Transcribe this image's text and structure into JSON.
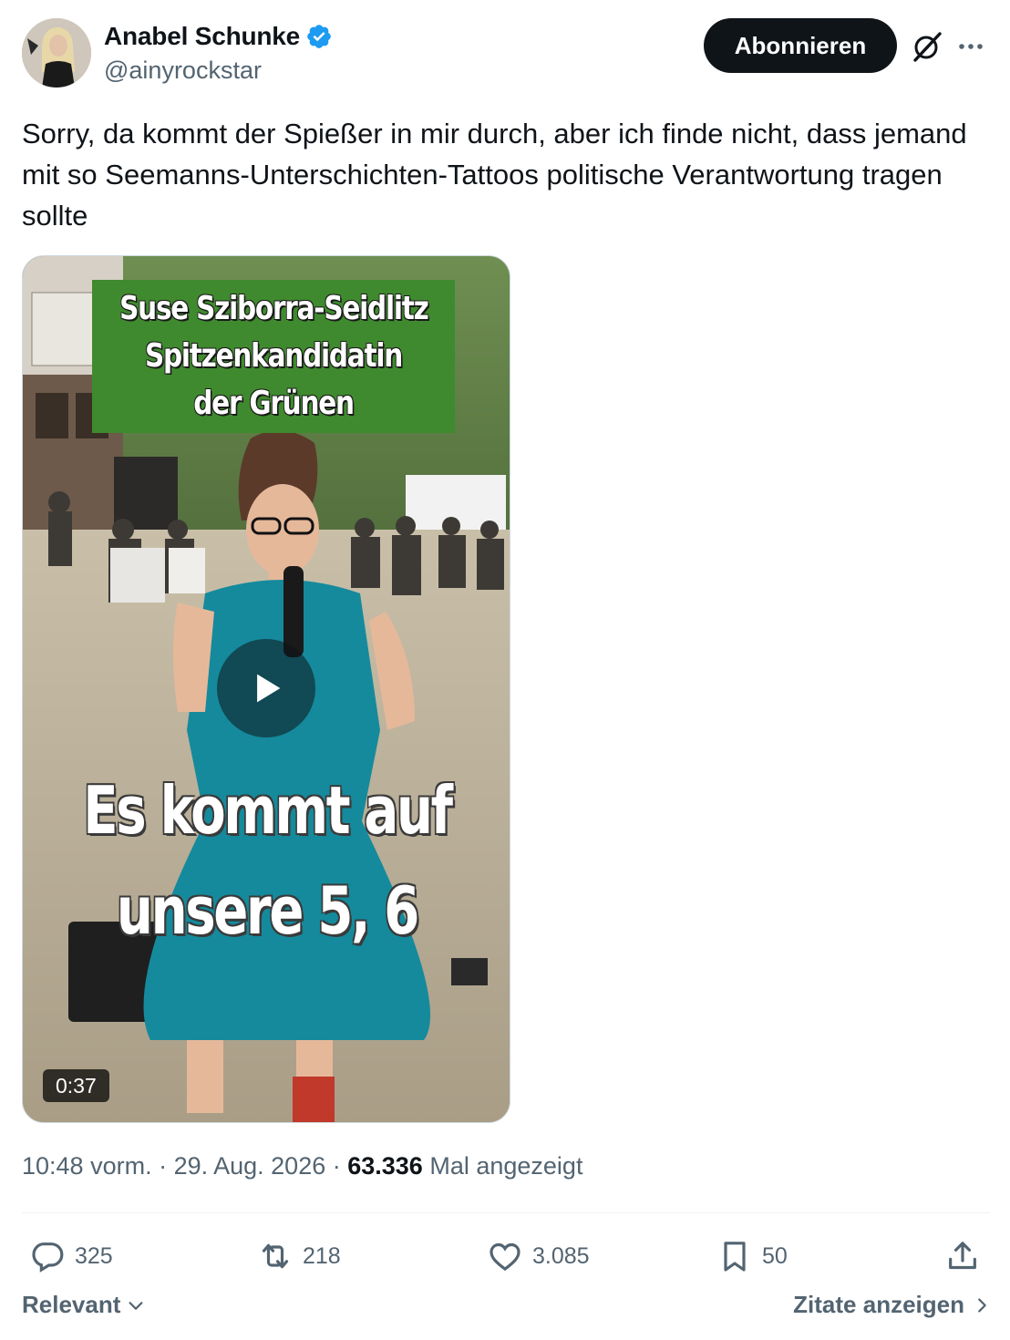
{
  "author": {
    "display_name": "Anabel Schunke",
    "handle": "@ainyrockstar",
    "verified": true,
    "verified_color": "#1d9bf0"
  },
  "header": {
    "follow_label": "Abonnieren",
    "grok_icon": "grok-icon",
    "more_icon": "more-icon"
  },
  "tweet": {
    "text": "Sorry, da kommt der Spießer in mir durch, aber ich finde nicht, dass jemand mit so Seemanns-Unterschichten-Tattoos politische Verantwortung tragen sollte"
  },
  "media": {
    "caption_lines": [
      "Suse Sziborra-Seidlitz",
      "Spitzenkandidatin",
      "der Grünen"
    ],
    "overlay_line_1": "Es kommt auf",
    "overlay_line_2": "unsere 5, 6",
    "duration": "0:37",
    "caption_color": "#3f8a2e"
  },
  "meta": {
    "time": "10:48 vorm.",
    "separator": " · ",
    "date": "29. Aug. 2026",
    "views_count": "63.336",
    "views_label": "Mal angezeigt"
  },
  "actions": {
    "replies": "325",
    "reposts": "218",
    "likes": "3.085",
    "bookmarks": "50"
  },
  "footer": {
    "sort_label": "Relevant",
    "quotes_label": "Zitate anzeigen"
  }
}
